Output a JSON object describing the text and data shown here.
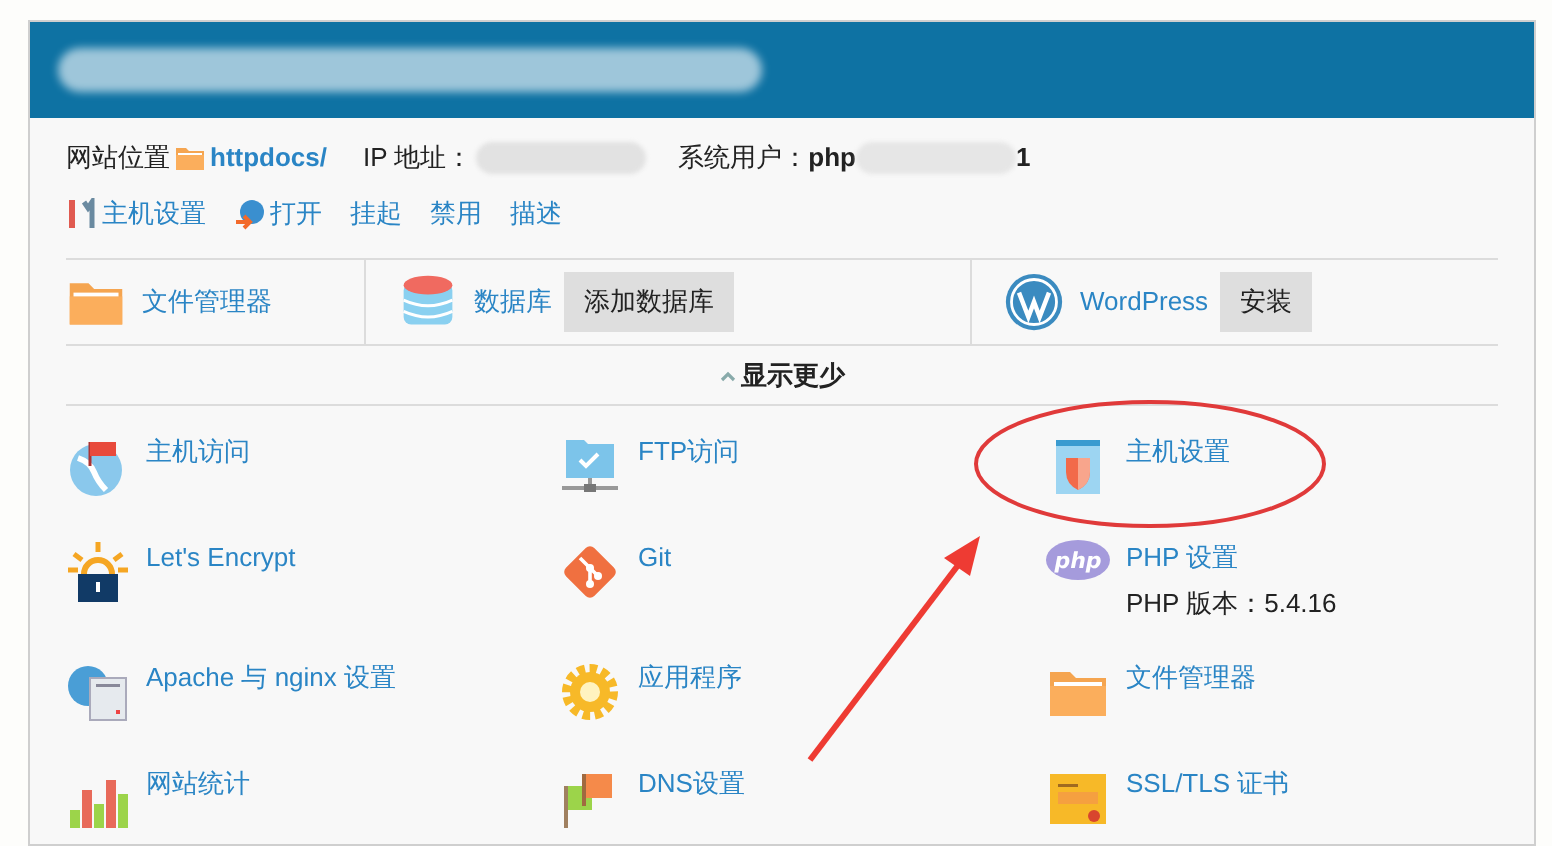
{
  "info": {
    "location_label": "网站位置",
    "location_link": "httpdocs/",
    "ip_label": "IP 地址：",
    "user_label": "系统用户：",
    "user_value_start": "php",
    "user_value_end": "1"
  },
  "actions": [
    {
      "kind": "wrench",
      "label": "主机设置"
    },
    {
      "kind": "globe-arrow",
      "label": "打开"
    },
    {
      "kind": "plain",
      "label": "挂起"
    },
    {
      "kind": "plain",
      "label": "禁用"
    },
    {
      "kind": "plain",
      "label": "描述"
    }
  ],
  "quick": [
    {
      "kind": "folder",
      "label": "文件管理器"
    },
    {
      "kind": "database",
      "label": "数据库",
      "button": "添加数据库"
    },
    {
      "kind": "wordpress",
      "label": "WordPress",
      "button": "安装"
    }
  ],
  "toggle": "显示更少",
  "tools": [
    {
      "kind": "globe-flag",
      "label": "主机访问",
      "circled": false
    },
    {
      "kind": "ftp",
      "label": "FTP访问",
      "circled": false
    },
    {
      "kind": "shield-doc",
      "label": "主机设置",
      "circled": true
    },
    {
      "kind": "lock",
      "label": "Let's Encrypt",
      "circled": false
    },
    {
      "kind": "git",
      "label": "Git",
      "circled": false
    },
    {
      "kind": "php",
      "label": "PHP 设置",
      "detail": "PHP 版本：5.4.16",
      "circled": false
    },
    {
      "kind": "server",
      "label": "Apache 与 nginx 设置",
      "circled": false
    },
    {
      "kind": "gear",
      "label": "应用程序",
      "circled": false
    },
    {
      "kind": "folder",
      "label": "文件管理器",
      "circled": false
    },
    {
      "kind": "bars",
      "label": "网站统计",
      "circled": false
    },
    {
      "kind": "flags",
      "label": "DNS设置",
      "circled": false
    },
    {
      "kind": "certificate",
      "label": "SSL/TLS 证书",
      "circled": false
    }
  ],
  "annotation_arrow": true
}
